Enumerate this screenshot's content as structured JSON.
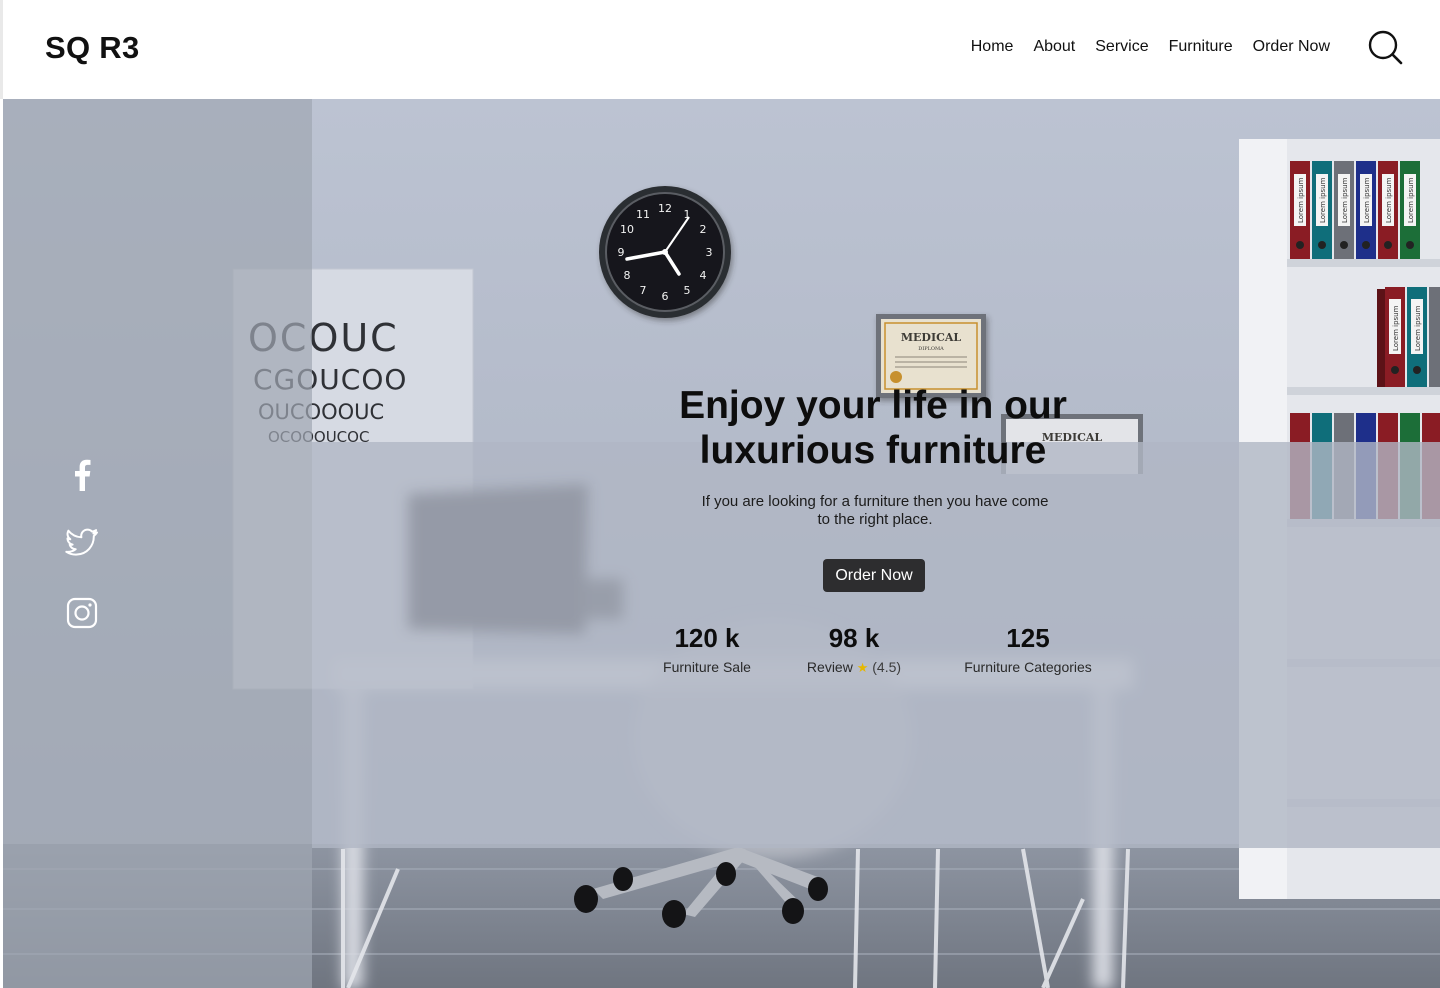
{
  "header": {
    "logo": "SQ R3",
    "nav": [
      "Home",
      "About",
      "Service",
      "Furniture",
      "Order Now"
    ]
  },
  "hero": {
    "headline_line1": "Enjoy your life in our",
    "headline_line2": "luxurious furniture",
    "subtext": "If you are looking for a furniture then you have come to the right place.",
    "cta_label": "Order Now",
    "stats": [
      {
        "value": "120 k",
        "label": "Furniture Sale"
      },
      {
        "value": "98 k",
        "label": "Review",
        "star": "★",
        "rating": "(4.5)"
      },
      {
        "value": "125",
        "label": "Furniture Categories"
      }
    ],
    "background_scene": {
      "wall_signs": [
        "MEDICAL",
        "DIPLOMA",
        "MEDICAL"
      ],
      "clock_numbers": [
        "12",
        "1",
        "2",
        "3",
        "4",
        "5",
        "6",
        "7",
        "8",
        "9",
        "10",
        "11"
      ],
      "binder_labels": [
        "Lorem ipsum",
        "Lorem ipsum",
        "Lorem ipsum",
        "Lorem ipsum",
        "Lorem ipsum",
        "Lorem ipsum",
        "Lorem ipsum",
        "Lorem ipsum"
      ]
    }
  },
  "social_icons": [
    "facebook-icon",
    "twitter-icon",
    "instagram-icon"
  ],
  "colors": {
    "cta_bg": "#2d2d2f",
    "side_panel": "#a0a6b2",
    "glass_panel": "#b0b6c4",
    "star": "#e6b800"
  }
}
